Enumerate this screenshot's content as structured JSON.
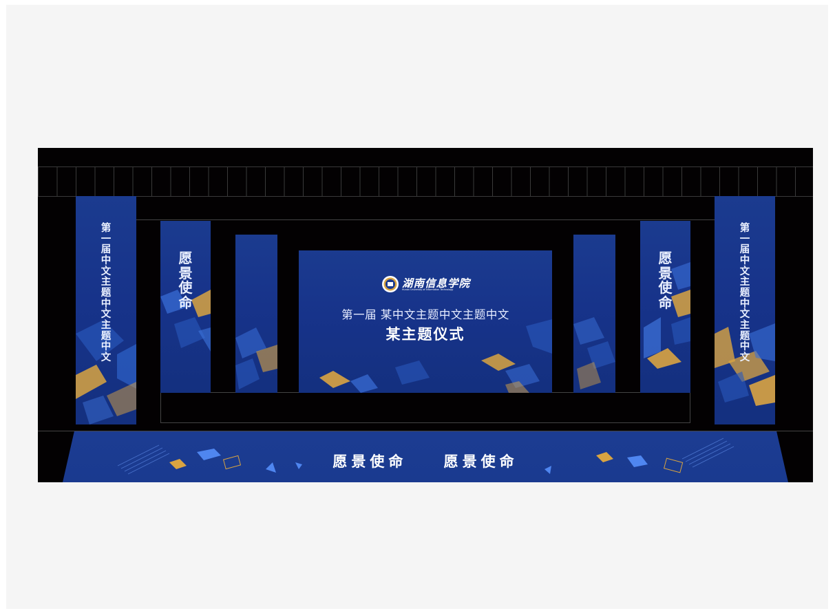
{
  "left_banner": [
    "第",
    "一",
    "届",
    "中",
    "文",
    "主",
    "题",
    "中",
    "文",
    "主",
    "题",
    "中",
    "文"
  ],
  "right_banner": [
    "第",
    "一",
    "届",
    "中",
    "文",
    "主",
    "题",
    "中",
    "文",
    "主",
    "题",
    "中",
    "文"
  ],
  "side_panel_text": [
    "愿",
    "景",
    "使",
    "命"
  ],
  "screen": {
    "logo_name": "湖南信息学院",
    "logo_subtitle": "Hunan University of Information Technology",
    "title_line1": "第一届 某中文主题中文主题中文",
    "title_line2": "某主题仪式"
  },
  "floor": {
    "slogan_left": "愿景使命",
    "slogan_right": "愿景使命"
  },
  "colors": {
    "panel_blue": "#1a3a8f",
    "accent_gold": "#d9a441",
    "stage_black": "#030102",
    "background": "#f5f5f5"
  }
}
